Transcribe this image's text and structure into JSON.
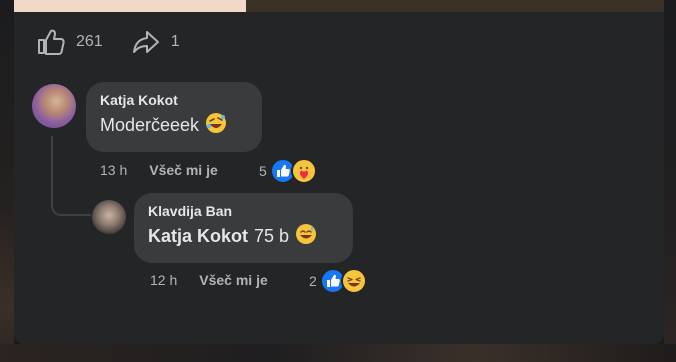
{
  "post_stats": {
    "likes": "261",
    "shares": "1"
  },
  "comments": [
    {
      "author": "Katja Kokot",
      "text": "Moderčeeek",
      "emoji": "rolling-laughing-emoji",
      "time": "13 h",
      "like_label": "Všeč mi je",
      "reaction_count": "5",
      "reactions": [
        "like-reaction",
        "heart-hug-reaction"
      ]
    },
    {
      "author": "Klavdija Ban",
      "mention": "Katja Kokot",
      "text": "75 b",
      "emoji": "sweat-smile-emoji",
      "time": "12 h",
      "like_label": "Všeč mi je",
      "reaction_count": "2",
      "reactions": [
        "like-reaction",
        "laugh-reaction"
      ]
    }
  ],
  "colors": {
    "card_bg": "#242526",
    "bubble_bg": "#3a3b3c",
    "like_blue": "#1877f2",
    "muted_text": "#b0b3b8"
  }
}
